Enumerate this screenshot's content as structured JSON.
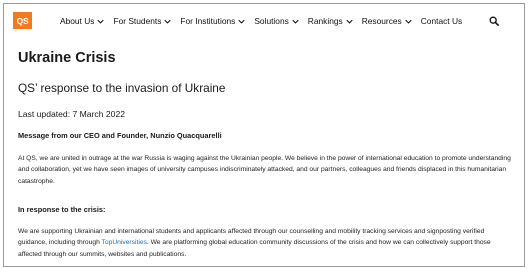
{
  "brand": {
    "logo_text": "QS",
    "accent": "#f47a20"
  },
  "nav": {
    "items": [
      {
        "label": "About Us",
        "has_dropdown": true
      },
      {
        "label": "For Students",
        "has_dropdown": true
      },
      {
        "label": "For Institutions",
        "has_dropdown": true
      },
      {
        "label": "Solutions",
        "has_dropdown": true
      },
      {
        "label": "Rankings",
        "has_dropdown": true
      },
      {
        "label": "Resources",
        "has_dropdown": true
      },
      {
        "label": "Contact Us",
        "has_dropdown": false
      }
    ],
    "search_icon": "search-icon"
  },
  "article": {
    "title": "Ukraine Crisis",
    "subtitle": "QS’ response to the invasion of Ukraine",
    "last_updated": "Last updated: 7 March 2022",
    "message_heading": "Message from our CEO and Founder, Nunzio Quacquarelli",
    "paragraph1": "At QS, we are united in outrage at the war Russia is waging against the Ukrainian people. We believe in the power of international education to promote understanding and collaboration, yet we have seen images of university campuses indiscriminately attacked, and our partners, colleagues and friends displaced in this humanitarian catastrophe.",
    "response_heading": "In response to the crisis:",
    "paragraph2_before_link": "We are supporting Ukrainian and international students and applicants affected through our counselling and mobility tracking services and signposting verified guidance, including through ",
    "paragraph2_link": "TopUniversities",
    "paragraph2_after_link": ". We are platforming global education community discussions of the crisis and how we can collectively support those affected through our summits, websites and publications."
  },
  "colors": {
    "link": "#1f6fb5",
    "text": "#1a1a1a"
  }
}
